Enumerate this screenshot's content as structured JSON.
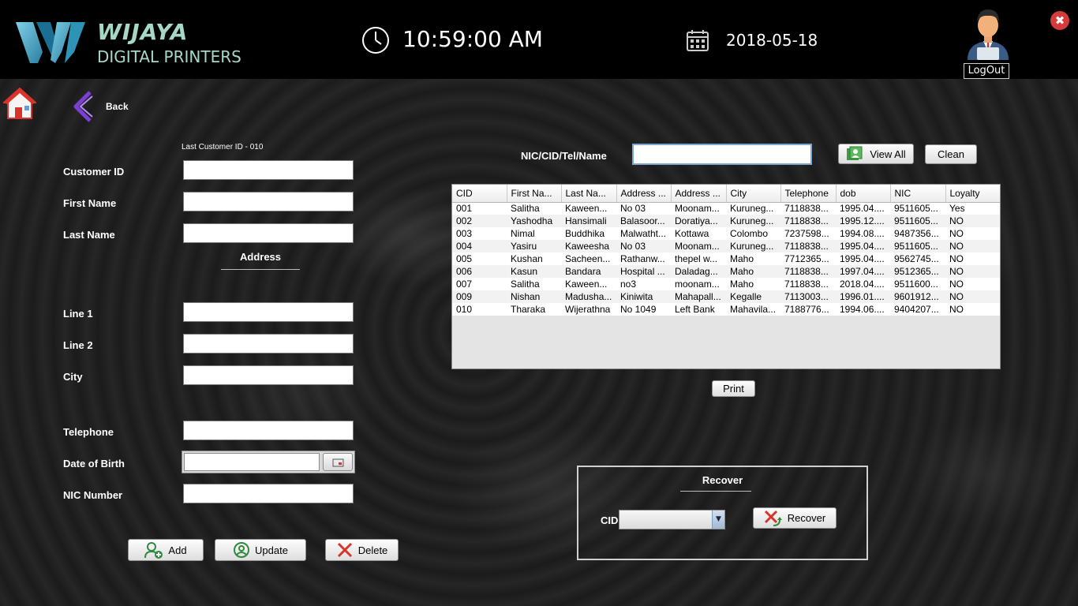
{
  "header": {
    "brand_title": "WIJAYA",
    "brand_subtitle": "DIGITAL PRINTERS",
    "time": "10:59:00 AM",
    "date": "2018-05-18",
    "logout_label": "LogOut",
    "close_glyph": "✖"
  },
  "nav": {
    "back_label": "Back"
  },
  "form": {
    "last_customer_id": "Last Customer ID -  010",
    "customer_id_label": "Customer ID",
    "first_name_label": "First Name",
    "last_name_label": "Last Name",
    "address_heading": "Address",
    "line1_label": "Line 1",
    "line2_label": "Line 2",
    "city_label": "City",
    "telephone_label": "Telephone",
    "dob_label": "Date of Birth",
    "nic_label": "NIC Number",
    "add_label": "Add",
    "update_label": "Update",
    "delete_label": "Delete"
  },
  "search": {
    "label": "NIC/CID/Tel/Name",
    "value": "",
    "view_all_label": "View All",
    "clean_label": "Clean"
  },
  "table": {
    "columns": [
      "CID",
      "First Na...",
      "Last Na...",
      "Address ...",
      "Address ...",
      "City",
      "Telephone",
      "dob",
      "NIC",
      "Loyalty"
    ],
    "rows": [
      [
        "001",
        "Salitha",
        "Kaween...",
        "No 03",
        "Moonam...",
        "Kuruneg...",
        "7118838...",
        "1995.04....",
        "9511605...",
        "Yes"
      ],
      [
        "002",
        "Yashodha",
        "Hansimali",
        "Balasoor...",
        "Doratiya...",
        "Kuruneg...",
        "7118838...",
        "1995.12....",
        "9511605...",
        "NO"
      ],
      [
        "003",
        "Nimal",
        "Buddhika",
        "Malwatht...",
        "Kottawa",
        "Colombo",
        "7237598...",
        "1994.08....",
        "9487356...",
        "NO"
      ],
      [
        "004",
        "Yasiru",
        "Kaweesha",
        "No 03",
        "Moonam...",
        "Kuruneg...",
        "7118838...",
        "1995.04....",
        "9511605...",
        "NO"
      ],
      [
        "005",
        "Kushan",
        "Sacheen...",
        "Rathanw...",
        "thepel w...",
        "Maho",
        "7712365...",
        "1995.04....",
        "9562745...",
        "NO"
      ],
      [
        "006",
        "Kasun",
        "Bandara",
        "Hospital ...",
        "Daladag...",
        "Maho",
        "7118838...",
        "1997.04....",
        "9512365...",
        "NO"
      ],
      [
        "007",
        "Salitha",
        "Kaween...",
        "no3",
        "moonam...",
        "Maho",
        "7118838...",
        "2018.04....",
        "9511600...",
        "NO"
      ],
      [
        "009",
        "Nishan",
        "Madusha...",
        "Kiniwita",
        "Mahapall...",
        "Kegalle",
        "7113003...",
        "1996.01....",
        "9601912...",
        "NO"
      ],
      [
        "010",
        "Tharaka",
        "Wijerathna",
        "No 1049",
        "Left Bank",
        "Mahavila...",
        "7188776...",
        "1994.06....",
        "9404207...",
        "NO"
      ]
    ]
  },
  "print_label": "Print",
  "recover": {
    "title": "Recover",
    "cid_label": "CID",
    "selected_value": "",
    "button_label": "Recover"
  }
}
